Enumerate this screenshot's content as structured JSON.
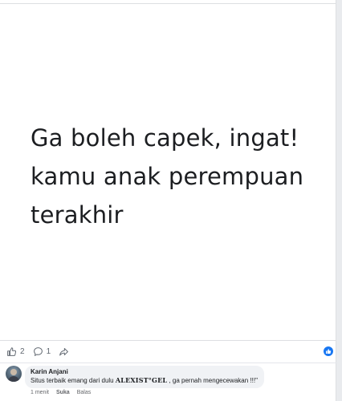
{
  "post": {
    "lines": [
      "Ga boleh capek, ingat!",
      "kamu anak perempuan",
      "terakhir"
    ]
  },
  "actions": {
    "like_count": "2",
    "comment_count": "1"
  },
  "comment": {
    "author": "Karin Anjani",
    "text_before": "Situs terbaik emang dari dulu ",
    "brand": "ALEXIST°GEL",
    "text_after": " , ga pernah mengecewakan !!!\"",
    "time": "1 menit",
    "like_label": "Suka",
    "reply_label": "Balas"
  },
  "icons": {
    "like": "thumbs-up-icon",
    "comment": "comment-bubble-icon",
    "share": "share-arrow-icon",
    "reaction": "like-reaction-badge-icon"
  },
  "colors": {
    "accent": "#1877f2",
    "text": "#1c1e21",
    "muted": "#65676b",
    "bubble": "#f0f2f5"
  }
}
